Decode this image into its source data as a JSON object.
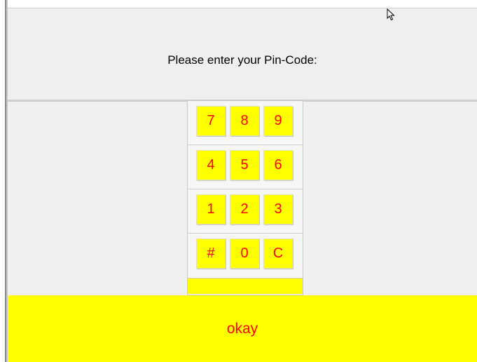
{
  "header": {
    "title": "Please enter your Pin-Code:"
  },
  "keypad": {
    "rows": [
      [
        "7",
        "8",
        "9"
      ],
      [
        "4",
        "5",
        "6"
      ],
      [
        "1",
        "2",
        "3"
      ],
      [
        "#",
        "0",
        "C"
      ]
    ],
    "pin_value": ""
  },
  "footer": {
    "okay_label": "okay"
  },
  "colors": {
    "key_bg": "#ffff00",
    "key_text": "#ff0000",
    "panel_bg": "#efefef"
  },
  "icons": {
    "cursor": "mouse-pointer-icon"
  }
}
